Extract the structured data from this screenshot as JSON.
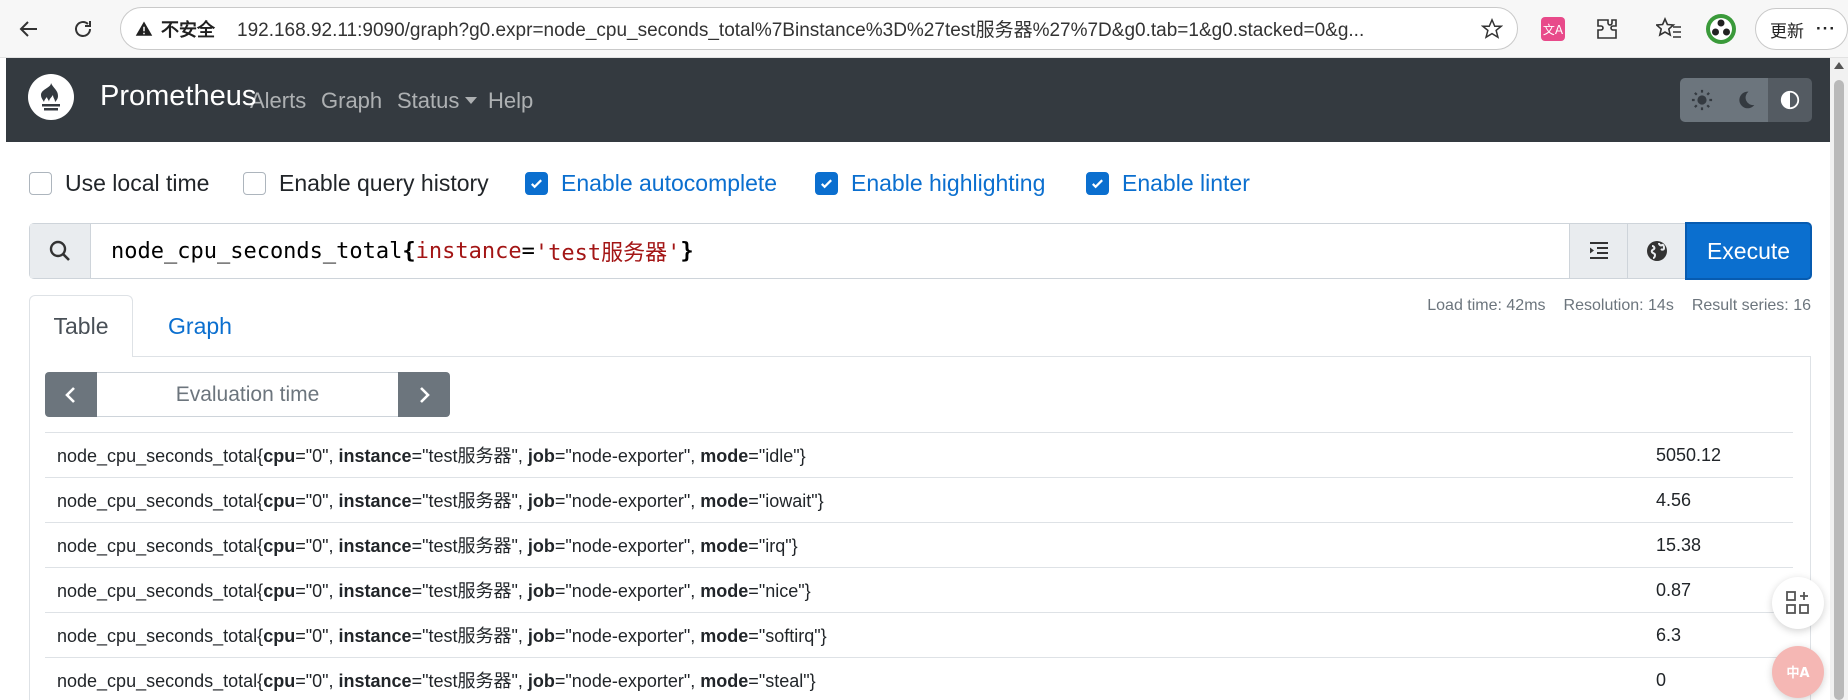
{
  "browser": {
    "security_label": "不安全",
    "url": "192.168.92.11:9090/graph?g0.expr=node_cpu_seconds_total%7Binstance%3D%27test服务器%27%7D&g0.tab=1&g0.stacked=0&g...",
    "update_label": "更新",
    "more_label": "···"
  },
  "navbar": {
    "brand": "Prometheus",
    "links": [
      "Alerts",
      "Graph",
      "Status",
      "Help"
    ],
    "theme_buttons": [
      "light-theme",
      "dark-theme",
      "auto-theme"
    ]
  },
  "options": [
    {
      "label": "Use local time",
      "checked": false
    },
    {
      "label": "Enable query history",
      "checked": false
    },
    {
      "label": "Enable autocomplete",
      "checked": true
    },
    {
      "label": "Enable highlighting",
      "checked": true
    },
    {
      "label": "Enable linter",
      "checked": true
    }
  ],
  "query": {
    "metric": "node_cpu_seconds_total",
    "open_brace": "{",
    "label": "instance",
    "op": "=",
    "value": "'test服务器'",
    "close_brace": "}",
    "execute_label": "Execute"
  },
  "stats": {
    "load_time": "Load time: 42ms",
    "resolution": "Resolution: 14s",
    "result_series": "Result series: 16"
  },
  "tabs": [
    "Table",
    "Graph"
  ],
  "eval_time_placeholder": "Evaluation time",
  "results": [
    {
      "metric": "node_cpu_seconds_total",
      "cpu": "\"0\"",
      "instance": "\"test服务器\"",
      "job": "\"node-exporter\"",
      "mode": "\"idle\"",
      "value": "5050.12"
    },
    {
      "metric": "node_cpu_seconds_total",
      "cpu": "\"0\"",
      "instance": "\"test服务器\"",
      "job": "\"node-exporter\"",
      "mode": "\"iowait\"",
      "value": "4.56"
    },
    {
      "metric": "node_cpu_seconds_total",
      "cpu": "\"0\"",
      "instance": "\"test服务器\"",
      "job": "\"node-exporter\"",
      "mode": "\"irq\"",
      "value": "15.38"
    },
    {
      "metric": "node_cpu_seconds_total",
      "cpu": "\"0\"",
      "instance": "\"test服务器\"",
      "job": "\"node-exporter\"",
      "mode": "\"nice\"",
      "value": "0.87"
    },
    {
      "metric": "node_cpu_seconds_total",
      "cpu": "\"0\"",
      "instance": "\"test服务器\"",
      "job": "\"node-exporter\"",
      "mode": "\"softirq\"",
      "value": "6.3"
    },
    {
      "metric": "node_cpu_seconds_total",
      "cpu": "\"0\"",
      "instance": "\"test服务器\"",
      "job": "\"node-exporter\"",
      "mode": "\"steal\"",
      "value": "0"
    }
  ],
  "colors": {
    "navbar_bg": "#343a40",
    "accent": "#0b6fcf",
    "secondary": "#6c757d"
  }
}
